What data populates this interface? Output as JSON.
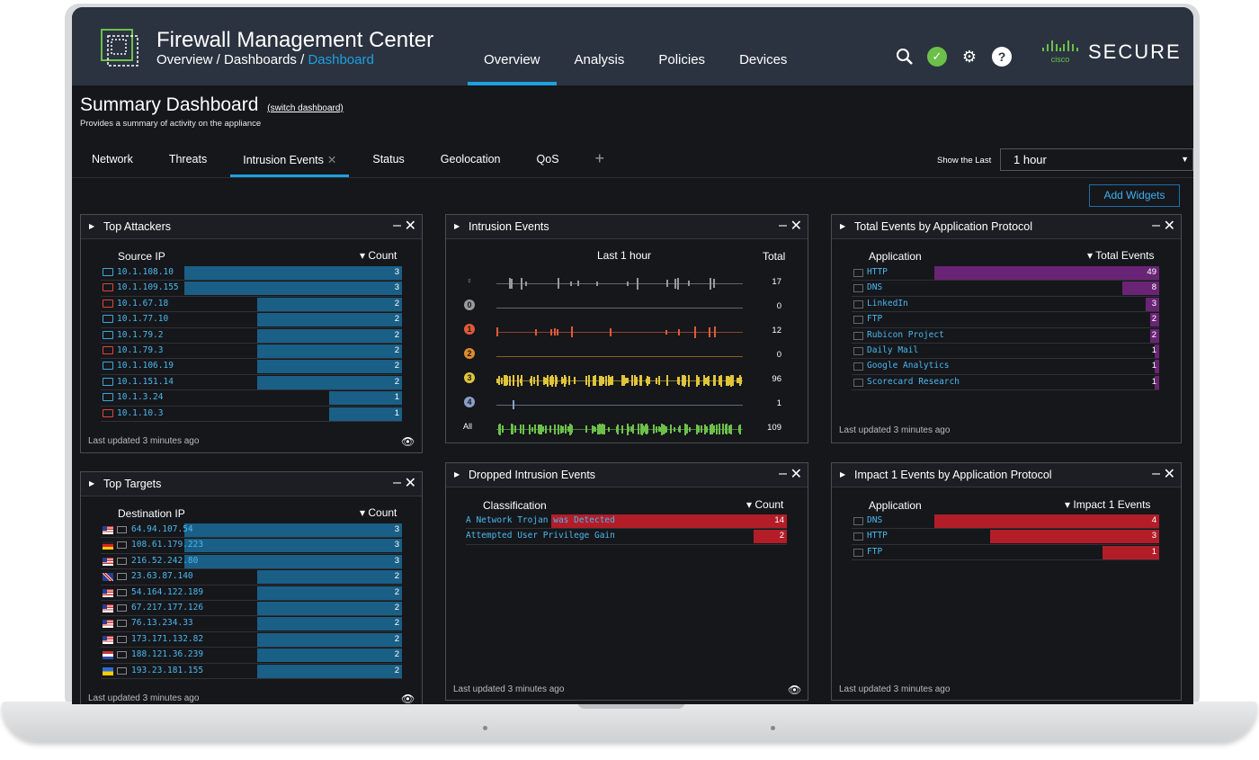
{
  "header": {
    "app_title": "Firewall Management Center",
    "breadcrumb": {
      "part1": "Overview",
      "part2": "Dashboards",
      "active": "Dashboard"
    },
    "nav": [
      "Overview",
      "Analysis",
      "Policies",
      "Devices"
    ],
    "brand": "SECURE",
    "brand_mark": "cisco"
  },
  "page": {
    "title": "Summary Dashboard",
    "switch_link": "(switch dashboard)",
    "subtitle": "Provides a summary of activity on the appliance"
  },
  "tabs": [
    "Network",
    "Threats",
    "Intrusion Events",
    "Status",
    "Geolocation",
    "QoS"
  ],
  "controls": {
    "show_last_label": "Show the Last",
    "range_value": "1 hour",
    "add_widgets": "Add Widgets"
  },
  "widgets": {
    "top_attackers": {
      "title": "Top Attackers",
      "col_label": "Source IP",
      "col_value": "Count",
      "footer": "Last updated 3 minutes ago",
      "rows": [
        {
          "ip": "10.1.108.10",
          "count": "3",
          "color": "#3aa8e0"
        },
        {
          "ip": "10.1.109.155",
          "count": "3",
          "color": "#e0443a"
        },
        {
          "ip": "10.1.67.18",
          "count": "2",
          "color": "#e0443a"
        },
        {
          "ip": "10.1.77.10",
          "count": "2",
          "color": "#3aa8e0"
        },
        {
          "ip": "10.1.79.2",
          "count": "2",
          "color": "#3aa8e0"
        },
        {
          "ip": "10.1.79.3",
          "count": "2",
          "color": "#e0443a"
        },
        {
          "ip": "10.1.106.19",
          "count": "2",
          "color": "#3aa8e0"
        },
        {
          "ip": "10.1.151.14",
          "count": "2",
          "color": "#3aa8e0"
        },
        {
          "ip": "10.1.3.24",
          "count": "1",
          "color": "#3aa8e0"
        },
        {
          "ip": "10.1.10.3",
          "count": "1",
          "color": "#e0443a"
        }
      ]
    },
    "top_targets": {
      "title": "Top Targets",
      "col_label": "Destination IP",
      "col_value": "Count",
      "footer": "Last updated 3 minutes ago",
      "rows": [
        {
          "ip": "64.94.107.54",
          "count": "3",
          "flag": "us"
        },
        {
          "ip": "108.61.179.223",
          "count": "3",
          "flag": "de"
        },
        {
          "ip": "216.52.242.80",
          "count": "3",
          "flag": "us"
        },
        {
          "ip": "23.63.87.140",
          "count": "2",
          "flag": "gb"
        },
        {
          "ip": "54.164.122.189",
          "count": "2",
          "flag": "us"
        },
        {
          "ip": "67.217.177.126",
          "count": "2",
          "flag": "us"
        },
        {
          "ip": "76.13.234.33",
          "count": "2",
          "flag": "us"
        },
        {
          "ip": "173.171.132.82",
          "count": "2",
          "flag": "us"
        },
        {
          "ip": "188.121.36.239",
          "count": "2",
          "flag": "nl"
        },
        {
          "ip": "193.23.181.155",
          "count": "2",
          "flag": "ua"
        }
      ]
    },
    "intrusion_events": {
      "title": "Intrusion Events",
      "period": "Last 1 hour",
      "total_label": "Total",
      "rows": [
        {
          "sev": "",
          "total": "17",
          "color": "#999999"
        },
        {
          "sev": "0",
          "total": "0",
          "color": "#9a9a9a"
        },
        {
          "sev": "1",
          "total": "12",
          "color": "#e05a3a"
        },
        {
          "sev": "2",
          "total": "0",
          "color": "#e08a2a"
        },
        {
          "sev": "3",
          "total": "96",
          "color": "#e0c43a"
        },
        {
          "sev": "4",
          "total": "1",
          "color": "#8aa0c8"
        },
        {
          "sev": "All",
          "total": "109",
          "color": "#6cc04a"
        }
      ]
    },
    "app_protocol": {
      "title": "Total Events by Application Protocol",
      "col_label": "Application",
      "col_value": "Total Events",
      "footer": "Last updated 3 minutes ago",
      "rows": [
        {
          "name": "HTTP",
          "count": "49"
        },
        {
          "name": "DNS",
          "count": "8"
        },
        {
          "name": "LinkedIn",
          "count": "3"
        },
        {
          "name": "FTP",
          "count": "2"
        },
        {
          "name": "Rubicon Project",
          "count": "2"
        },
        {
          "name": "Daily Mail",
          "count": "1"
        },
        {
          "name": "Google Analytics",
          "count": "1"
        },
        {
          "name": "Scorecard Research",
          "count": "1"
        }
      ]
    },
    "dropped": {
      "title": "Dropped Intrusion Events",
      "col_label": "Classification",
      "col_value": "Count",
      "footer": "Last updated 3 minutes ago",
      "rows": [
        {
          "name": "A Network Trojan was Detected",
          "count": "14"
        },
        {
          "name": "Attempted User Privilege Gain",
          "count": "2"
        }
      ]
    },
    "impact1": {
      "title": "Impact 1 Events by Application Protocol",
      "col_label": "Application",
      "col_value": "Impact 1 Events",
      "footer": "Last updated 3 minutes ago",
      "rows": [
        {
          "name": "DNS",
          "count": "4"
        },
        {
          "name": "HTTP",
          "count": "3"
        },
        {
          "name": "FTP",
          "count": "1"
        }
      ]
    }
  }
}
